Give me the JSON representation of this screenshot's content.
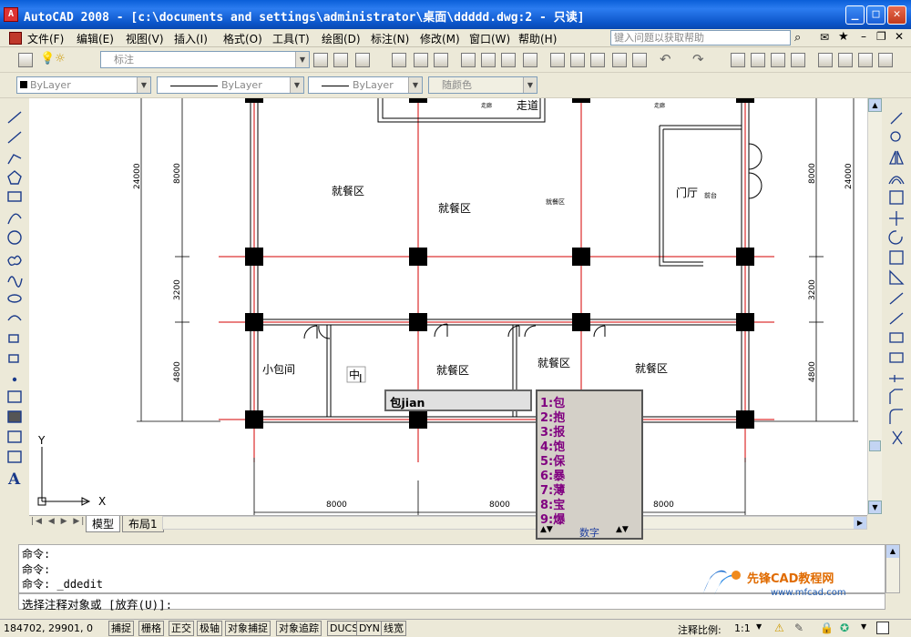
{
  "window": {
    "title": "AutoCAD 2008 - [c:\\documents and settings\\administrator\\桌面\\ddddd.dwg:2 - 只读]",
    "icon": "autocad-icon"
  },
  "menu": {
    "items": [
      "文件(F)",
      "编辑(E)",
      "视图(V)",
      "插入(I)",
      "格式(O)",
      "工具(T)",
      "绘图(D)",
      "标注(N)",
      "修改(M)",
      "窗口(W)",
      "帮助(H)"
    ],
    "help_placeholder": "键入问题以获取帮助"
  },
  "toolbar": {
    "layer_name": "标注",
    "color": "ByLayer",
    "linetype": "ByLayer",
    "lineweight": "ByLayer",
    "plotstyle": "随颜色"
  },
  "drawing": {
    "dims_left": [
      "24000",
      "8000",
      "3200",
      "4800"
    ],
    "dims_right": [
      "8000",
      "24000",
      "3200",
      "4800"
    ],
    "dims_bottom": [
      "8000",
      "8000",
      "8000"
    ],
    "labels": {
      "corridor": "走道",
      "corridor_small_1": "走廊",
      "corridor_small_2": "走廊",
      "dining_1": "就餐区",
      "dining_2": "就餐区",
      "dining_small": "就餐区",
      "lobby": "门厅",
      "desk": "前台",
      "private": "小包间",
      "dining_3": "就餐区",
      "dining_4": "就餐区",
      "dining_5": "就餐区",
      "editing": "中"
    },
    "ucs": {
      "x": "X",
      "y": "Y"
    }
  },
  "tabs": {
    "model": "模型",
    "layout1": "布局1"
  },
  "ime": {
    "composition": "包jian",
    "candidates": [
      "1:包",
      "2:抱",
      "3:报",
      "4:饱",
      "5:保",
      "6:暴",
      "7:薄",
      "8:宝",
      "9:爆"
    ],
    "mode": "数字"
  },
  "command": {
    "history": [
      "命令:",
      "命令:",
      "命令: _ddedit"
    ],
    "prompt": "选择注释对象或 [放弃(U)]:"
  },
  "status": {
    "coords": "184702, 29901, 0",
    "toggles": [
      "捕捉",
      "栅格",
      "正交",
      "极轴",
      "对象捕捉",
      "对象追踪",
      "DUCS",
      "DYN",
      "线宽"
    ],
    "annotation_scale_label": "注释比例:",
    "annotation_scale": "1:1"
  },
  "watermark": {
    "name": "先锋CAD教程网",
    "url": "www.mfcad.com"
  },
  "colors": {
    "titlebar": "#0a5fd8",
    "axis_red": "#d40000",
    "column": "#000000",
    "ime_candidate": "#800080"
  }
}
